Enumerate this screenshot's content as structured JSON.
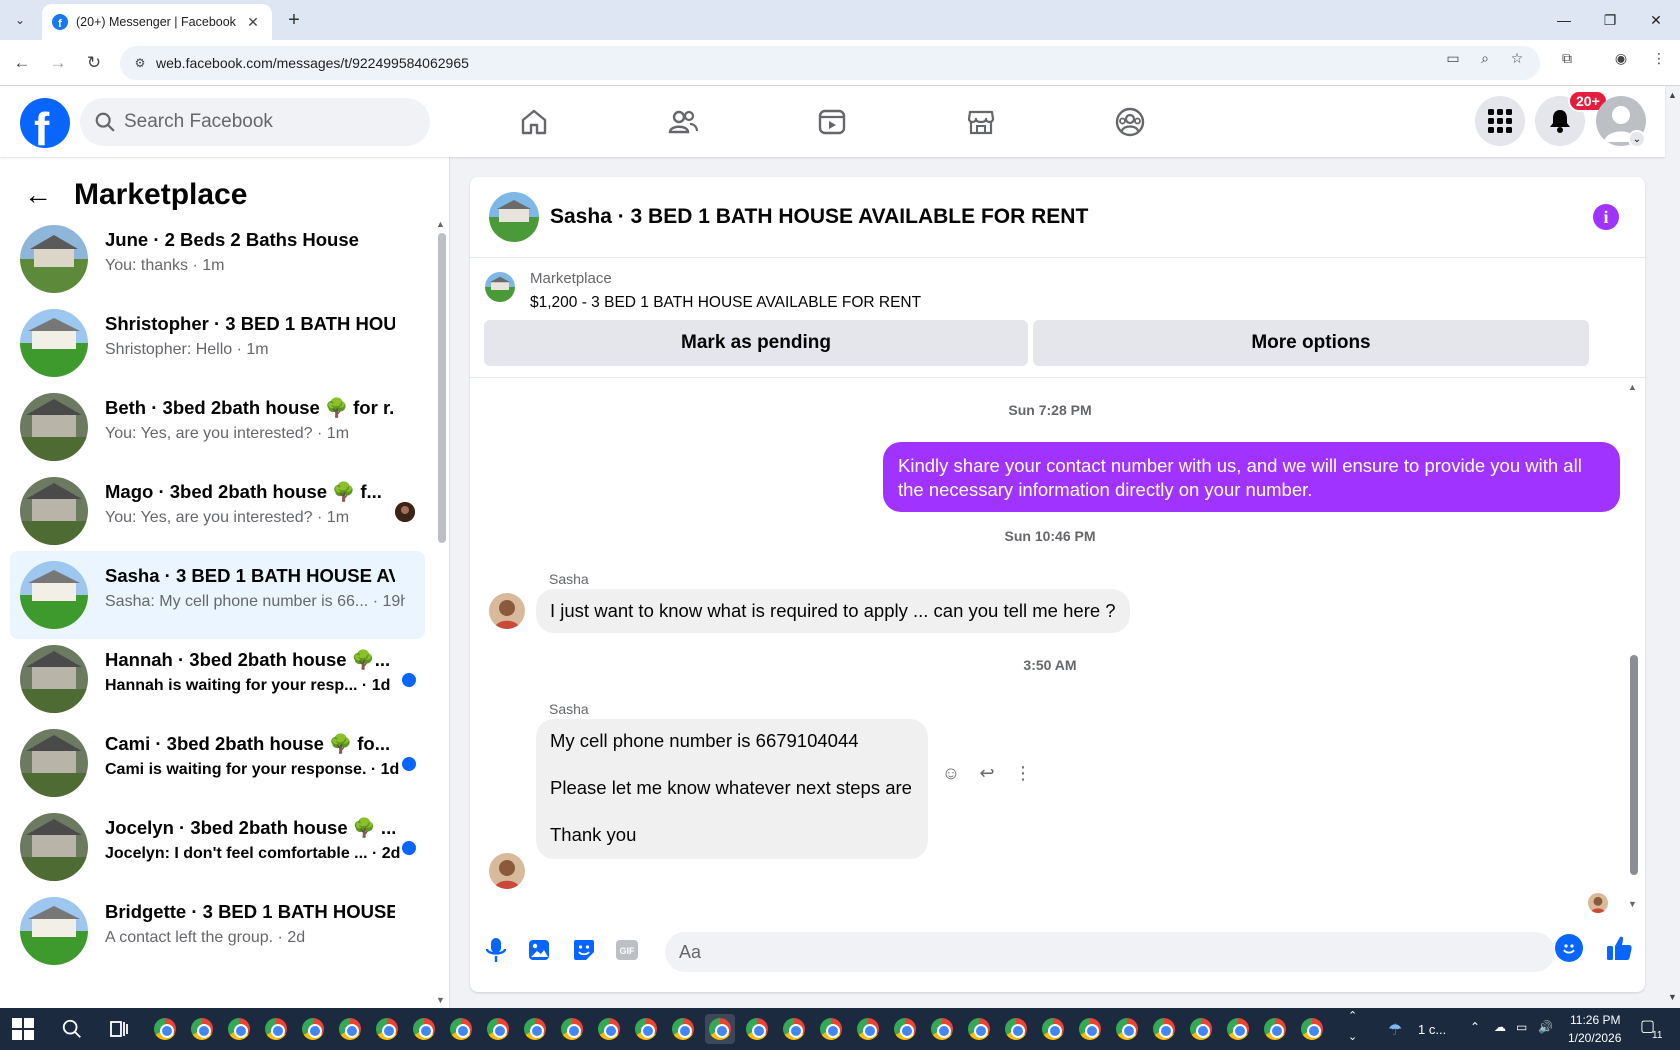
{
  "browser": {
    "tab_title": "(20+) Messenger | Facebook",
    "url": "web.facebook.com/messages/t/922499584062965"
  },
  "header": {
    "search_placeholder": "Search Facebook",
    "notification_count": "20+"
  },
  "sidebar": {
    "title": "Marketplace",
    "conversations": [
      {
        "title": "June · 2 Beds 2 Baths House",
        "preview": "You: thanks · 1m",
        "unread": false,
        "active": false
      },
      {
        "title": "Shristopher · 3 BED 1 BATH HOU...",
        "preview": "Shristopher: Hello · 1m",
        "unread": false,
        "active": false
      },
      {
        "title": "Beth · 3bed 2bath house 🌳 for r...",
        "preview": "You: Yes, are you interested? · 1m",
        "unread": false,
        "active": false
      },
      {
        "title": "Mago · 3bed 2bath house 🌳 f...",
        "preview": "You: Yes, are you interested? · 1m",
        "unread": false,
        "active": false
      },
      {
        "title": "Sasha · 3 BED 1 BATH HOUSE AV...",
        "preview": "Sasha: My cell phone number is 66... · 19h",
        "unread": false,
        "active": true
      },
      {
        "title": "Hannah · 3bed 2bath house 🌳...",
        "preview": "Hannah is waiting for your resp... · 1d",
        "unread": true,
        "active": false
      },
      {
        "title": "Cami · 3bed 2bath house 🌳 fo...",
        "preview": "Cami is waiting for your response. · 1d",
        "unread": true,
        "active": false
      },
      {
        "title": "Jocelyn · 3bed 2bath house 🌳 ...",
        "preview": "Jocelyn: I don't feel comfortable ... · 2d",
        "unread": true,
        "active": false
      },
      {
        "title": "Bridgette · 3 BED 1 BATH HOUSE...",
        "preview": "A contact left the group. · 2d",
        "unread": false,
        "active": false
      }
    ]
  },
  "chat": {
    "title": "Sasha · 3 BED 1 BATH HOUSE AVAILABLE FOR RENT",
    "listing_source": "Marketplace",
    "listing_desc": "$1,200 - 3 BED 1 BATH HOUSE AVAILABLE FOR RENT",
    "mark_pending_label": "Mark as pending",
    "more_options_label": "More options",
    "ts1": "Sun 7:28 PM",
    "outgoing_msg": "Kindly share your contact number with us, and we will ensure to provide you with all the necessary information directly on your number.",
    "ts2": "Sun 10:46 PM",
    "sender1": "Sasha",
    "incoming_msg1": "I just want to know what is required to apply ... can you tell me here ?",
    "ts3": "3:50 AM",
    "sender2": "Sasha",
    "incoming_msg2_line1": "My cell phone number is 6679104044",
    "incoming_msg2_line2": "Please let me know whatever next steps are",
    "incoming_msg2_line3": "Thank you",
    "composer_placeholder": "Aa"
  },
  "taskbar": {
    "weather": "1 c...",
    "time": "11:26 PM",
    "date": "1/20/2026",
    "notif_count": "11"
  },
  "colors": {
    "fb_blue": "#0866ff",
    "outgoing_bubble": "#a033ff",
    "active_row": "#ebf5ff",
    "badge_red": "#e41e3f"
  }
}
